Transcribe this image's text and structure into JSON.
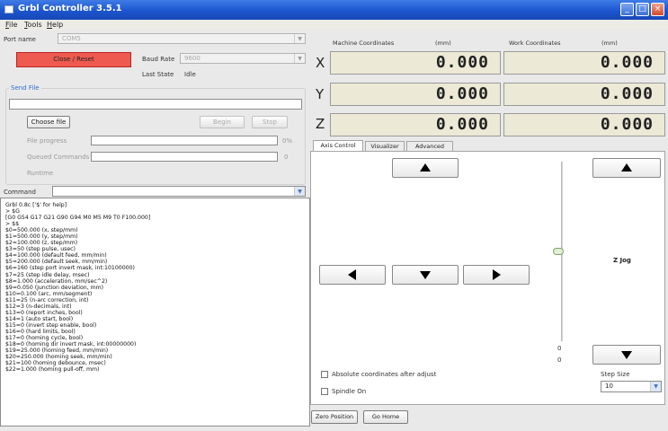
{
  "window": {
    "title": "Grbl Controller 3.5.1"
  },
  "menu": [
    "File",
    "Tools",
    "Help"
  ],
  "port": {
    "label": "Port name",
    "value": "COM5"
  },
  "reset_button": "Close / Reset",
  "baud": {
    "label": "Baud Rate",
    "value": "9600"
  },
  "last_state": {
    "label": "Last State",
    "value": "Idle"
  },
  "send_file": {
    "title": "Send File",
    "choose_button": "Choose file",
    "begin_button": "Begin",
    "stop_button": "Stop",
    "progress_label": "File progress",
    "progress_value": "0%",
    "queued_label": "Queued Commands",
    "queued_value": "0",
    "runtime_label": "Runtime"
  },
  "command": {
    "label": "Command",
    "value": ""
  },
  "console_lines": [
    "Grbl 0.8c ['$' for help]",
    "> $G",
    "[G0 G54 G17 G21 G90 G94 M0 M5 M9 T0 F100.000]",
    "> $$",
    "$0=500.000 (x, step/mm)",
    "$1=500.000 (y, step/mm)",
    "$2=100.000 (z, step/mm)",
    "$3=50 (step pulse, usec)",
    "$4=100.000 (default feed, mm/min)",
    "$5=200.000 (default seek, mm/min)",
    "$6=160 (step port invert mask, int:10100000)",
    "$7=25 (step idle delay, msec)",
    "$8=1.000 (acceleration, mm/sec^2)",
    "$9=0.050 (junction deviation, mm)",
    "$10=0.100 (arc, mm/segment)",
    "$11=25 (n-arc correction, int)",
    "$12=3 (n-decimals, int)",
    "$13=0 (report inches, bool)",
    "$14=1 (auto start, bool)",
    "$15=0 (invert step enable, bool)",
    "$16=0 (hard limits, bool)",
    "$17=0 (homing cycle, bool)",
    "$18=0 (homing dir invert mask, int:00000000)",
    "$19=25.000 (homing feed, mm/min)",
    "$20=250.000 (homing seek, mm/min)",
    "$21=100 (homing debounce, msec)",
    "$22=1.000 (homing pull-off, mm)"
  ],
  "coords": {
    "machine_label": "Machine Coordinates",
    "work_label": "Work Coordinates",
    "unit": "(mm)",
    "axes": [
      {
        "name": "X",
        "machine": "0.000",
        "work": "0.000"
      },
      {
        "name": "Y",
        "machine": "0.000",
        "work": "0.000"
      },
      {
        "name": "Z",
        "machine": "0.000",
        "work": "0.000"
      }
    ]
  },
  "tabs": [
    "Axis Control",
    "Visualizer",
    "Advanced"
  ],
  "axis_control": {
    "z_jog_label": "Z Jog",
    "slider_min": "0",
    "slider_value": "0",
    "absolute_label": "Absolute coordinates after adjust",
    "spindle_label": "Spindle On",
    "step_size_label": "Step Size",
    "step_size_value": "10"
  },
  "bottom": {
    "zero_button": "Zero Position",
    "home_button": "Go Home"
  },
  "colors": {
    "title_bar": "#1c55cf",
    "reset_button": "#ee5a4f",
    "dro_background": "#ece9d6",
    "group_title": "#2f6fcf"
  }
}
